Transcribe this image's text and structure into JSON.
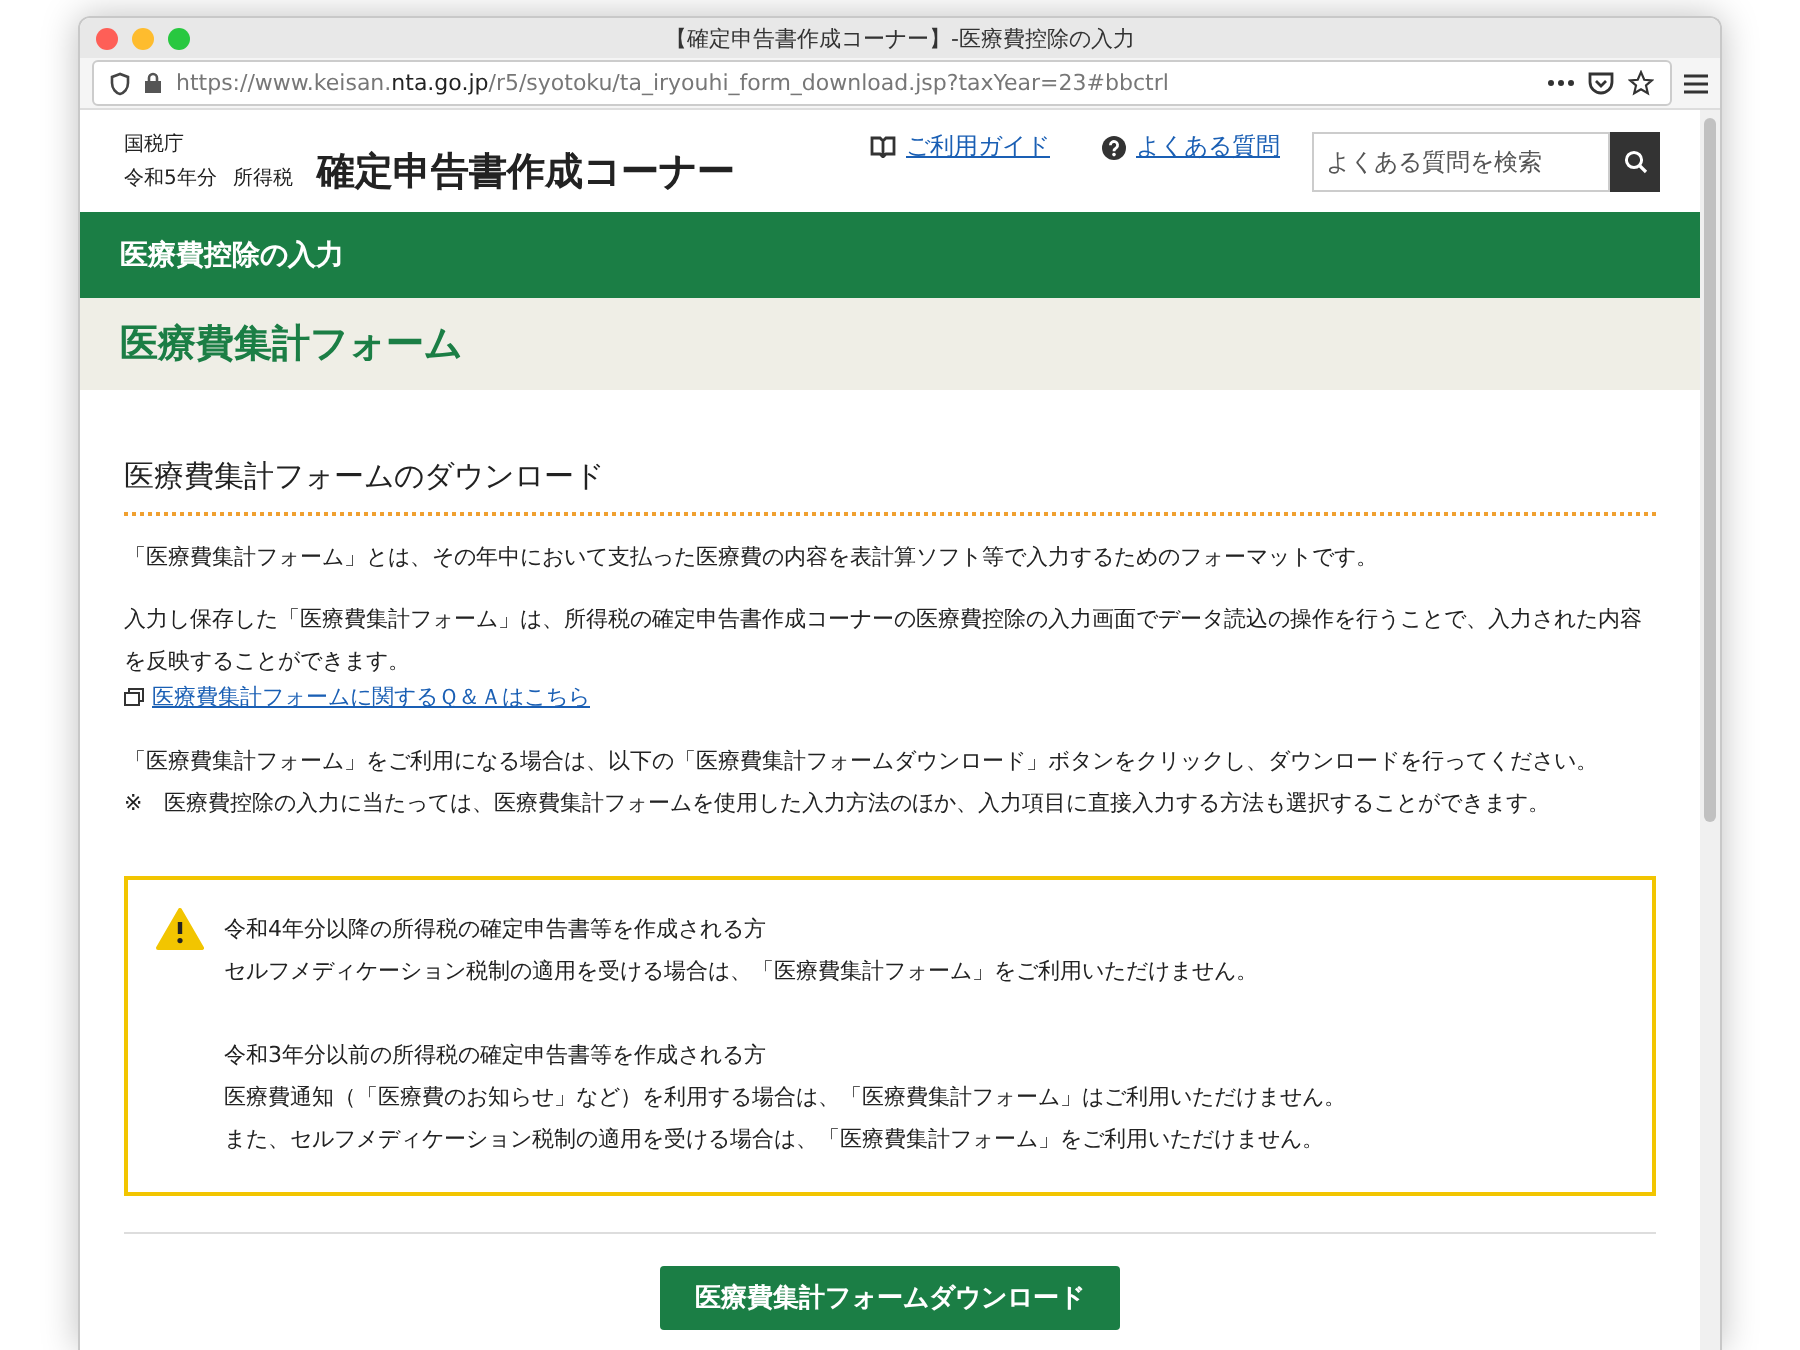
{
  "window": {
    "title": "【確定申告書作成コーナー】-医療費控除の入力"
  },
  "address_bar": {
    "url": "https://www.keisan.**nta.go.jp**/r5/syotoku/ta_iryouhi_form_download.jsp?taxYear=23#bbctrl"
  },
  "header": {
    "agency": "国税庁",
    "year": "令和5年分",
    "tax": "所得税",
    "title": "確定申告書作成コーナー",
    "links": [
      {
        "kind": "guide",
        "label": "ご利用ガイド"
      },
      {
        "kind": "faq",
        "label": "よくある質問"
      }
    ],
    "search": {
      "placeholder": "よくある質問を検索"
    }
  },
  "section_bar": {
    "title": "医療費控除の入力"
  },
  "page_title": "医療費集計フォーム",
  "content": {
    "heading": "医療費集計フォームのダウンロード",
    "paragraphs": [
      "「医療費集計フォーム」とは、その年中において支払った医療費の内容を表計算ソフト等で入力するためのフォーマットです。",
      "入力し保存した「医療費集計フォーム」は、所得税の確定申告書作成コーナーの医療費控除の入力画面でデータ読込の操作を行うことで、入力された内容を反映することができます。"
    ],
    "qa_link": "医療費集計フォームに関するＱ＆Ａはこちら",
    "instructions": [
      "「医療費集計フォーム」をご利用になる場合は、以下の「医療費集計フォームダウンロード」ボタンをクリックし、ダウンロードを行ってください。",
      "※　医療費控除の入力に当たっては、医療費集計フォームを使用した入力方法のほか、入力項目に直接入力する方法も選択することができます。"
    ],
    "notice": [
      {
        "heading": "令和4年分以降の所得税の確定申告書等を作成される方",
        "lines": [
          "セルフメディケーション税制の適用を受ける場合は、「医療費集計フォーム」をご利用いただけません。"
        ]
      },
      {
        "heading": "令和3年分以前の所得税の確定申告書等を作成される方",
        "lines": [
          "医療費通知（「医療費のお知らせ」など）を利用する場合は、「医療費集計フォーム」はご利用いただけません。",
          "また、セルフメディケーション税制の適用を受ける場合は、「医療費集計フォーム」をご利用いただけません。"
        ]
      }
    ],
    "download_button": "医療費集計フォームダウンロード"
  }
}
